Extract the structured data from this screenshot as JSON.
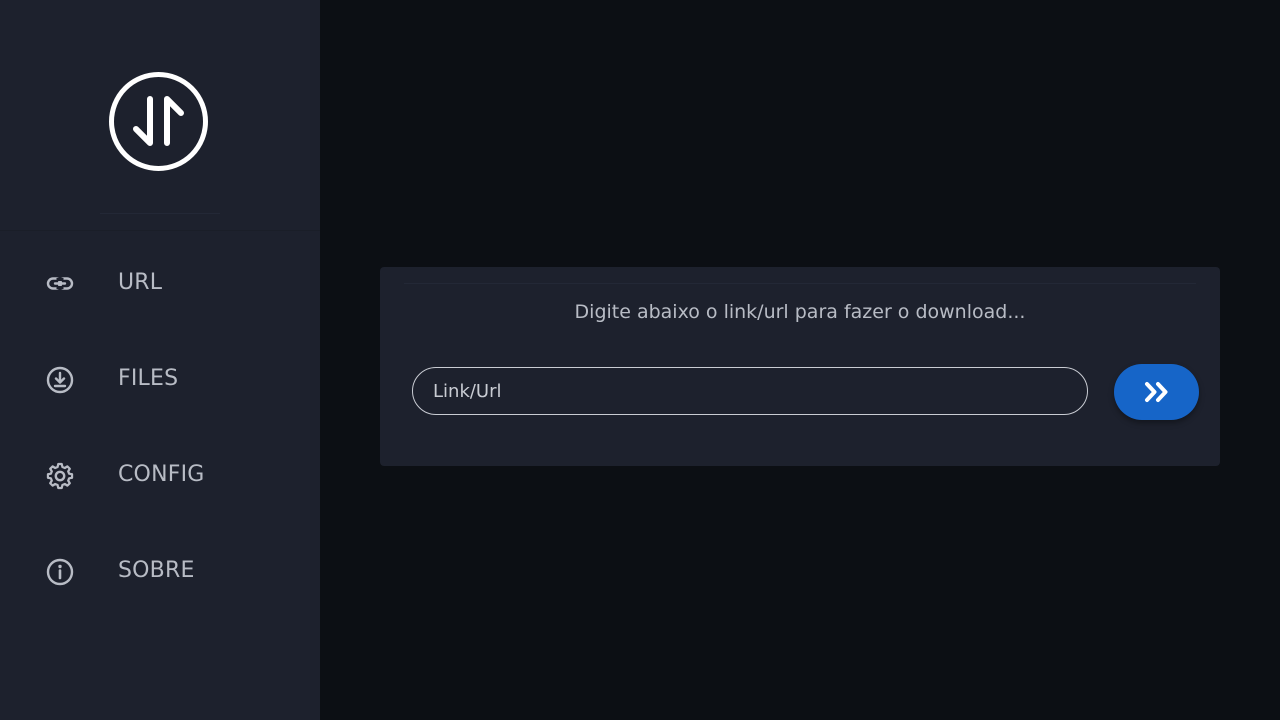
{
  "sidebar": {
    "logo_icon": "arrows-up-down-circle-icon",
    "items": [
      {
        "label": "URL",
        "icon": "link-icon"
      },
      {
        "label": "FILES",
        "icon": "download-circle-icon"
      },
      {
        "label": "CONFIG",
        "icon": "gear-icon"
      },
      {
        "label": "SOBRE",
        "icon": "info-circle-icon"
      }
    ]
  },
  "main": {
    "card": {
      "title": "Digite abaixo o link/url para fazer o download...",
      "url_input": {
        "value": "",
        "placeholder": "Link/Url"
      },
      "submit_icon": "double-chevron-right-icon"
    }
  },
  "colors": {
    "background": "#0c0f14",
    "sidebar": "#1d212d",
    "card": "#1d212d",
    "text": "#b8bcc5",
    "accent": "#1665c8"
  }
}
